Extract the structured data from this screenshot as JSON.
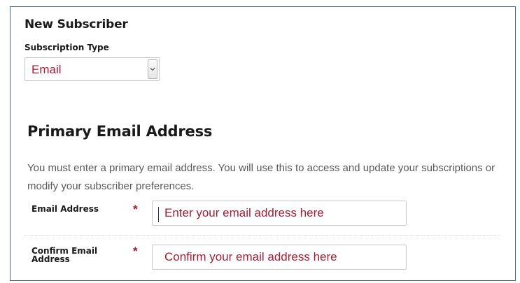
{
  "form": {
    "title": "New Subscriber",
    "subscription_type": {
      "label": "Subscription Type",
      "selected": "Email"
    }
  },
  "primary_email": {
    "title": "Primary Email Address",
    "description": "You must enter a primary email address. You will use this to access and update your subscriptions or modify your subscriber preferences.",
    "fields": [
      {
        "label": "Email Address",
        "required_mark": "*",
        "placeholder": "Enter your email address here",
        "value": ""
      },
      {
        "label": "Confirm Email Address",
        "required_mark": "*",
        "placeholder": "Confirm your email address here",
        "value": ""
      }
    ]
  },
  "colors": {
    "accent": "#a41e34",
    "frame_border": "#4a6a8a",
    "input_border": "#c8c8c8",
    "description_text": "#595959"
  },
  "icons": {
    "select_arrow": "chevron-down-icon"
  }
}
